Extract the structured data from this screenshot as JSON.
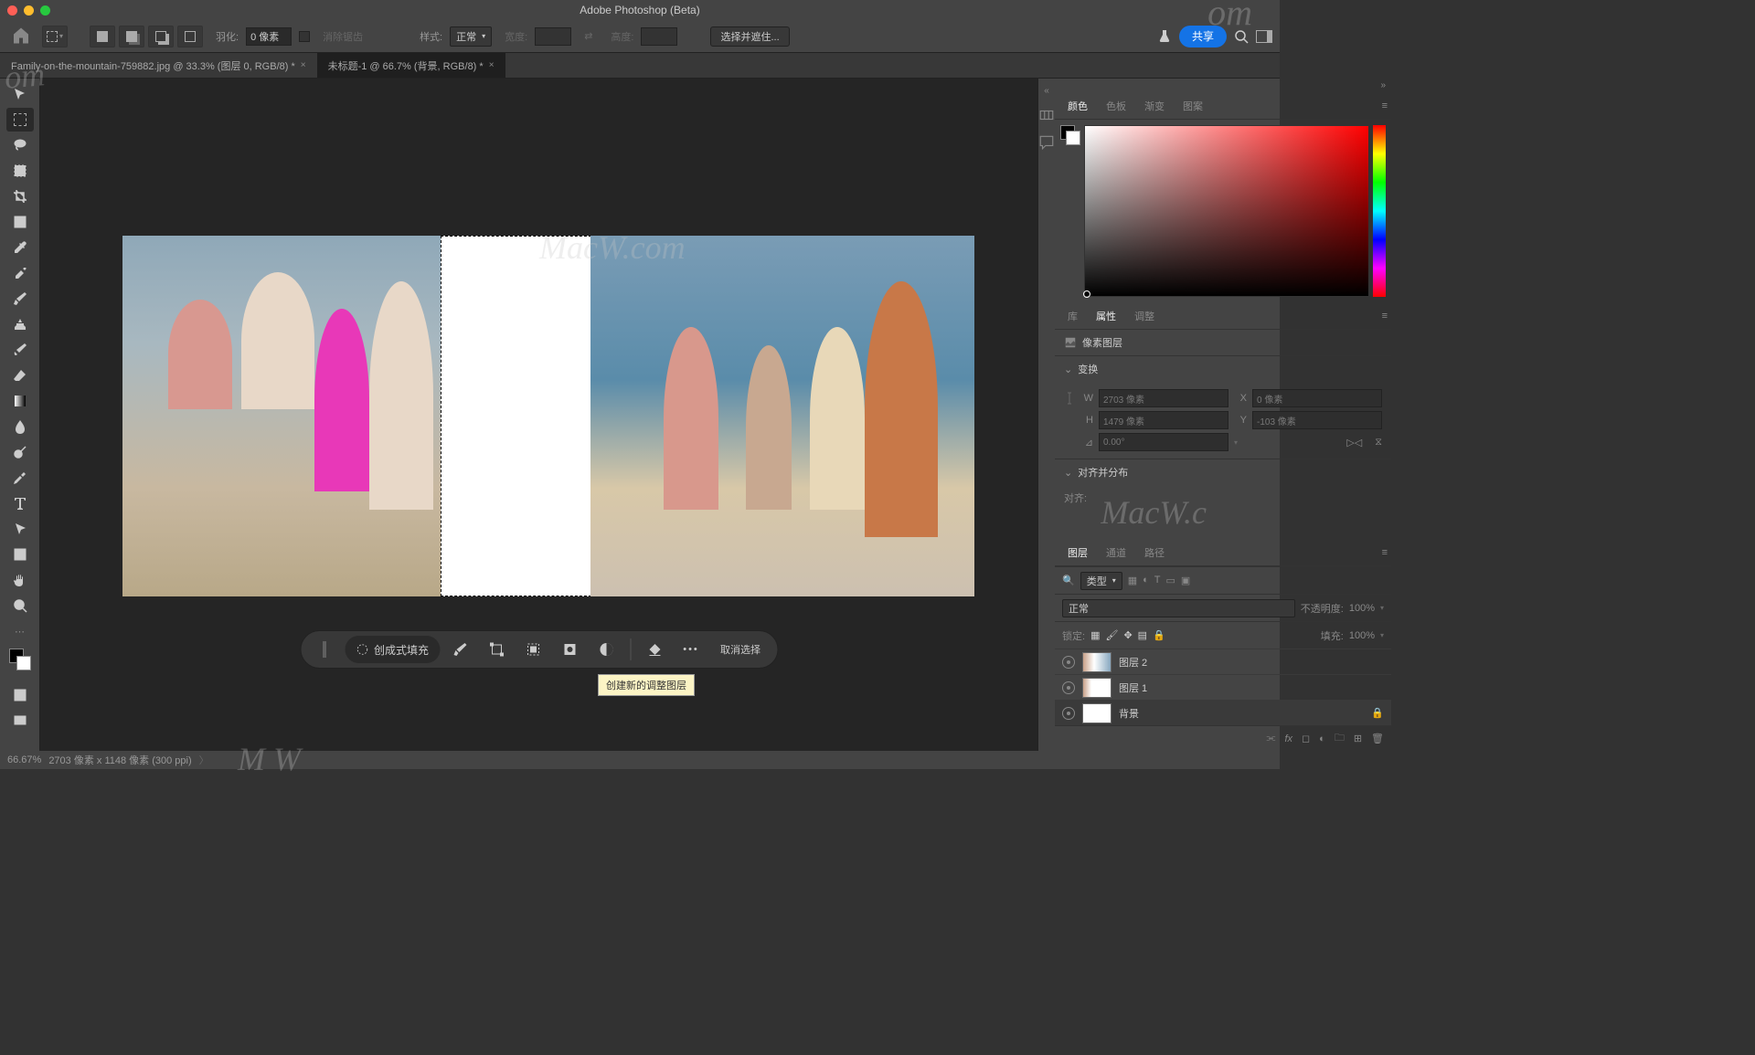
{
  "titlebar": {
    "title": "Adobe Photoshop (Beta)"
  },
  "toolbar": {
    "feather_label": "羽化:",
    "feather_value": "0 像素",
    "antialias": "消除锯齿",
    "style_label": "样式:",
    "style_value": "正常",
    "width_label": "宽度:",
    "height_label": "高度:",
    "select_and_mask": "选择并遮住...",
    "share": "共享"
  },
  "tabs": [
    {
      "label": "Family-on-the-mountain-759882.jpg @ 33.3% (图层 0, RGB/8) *",
      "active": false
    },
    {
      "label": "未标题-1 @ 66.7% (背景, RGB/8) *",
      "active": true
    }
  ],
  "floating_bar": {
    "generative_fill": "创成式填充",
    "deselect": "取消选择"
  },
  "tooltip": "创建新的调整图层",
  "color_panel": {
    "tabs": [
      "颜色",
      "色板",
      "渐变",
      "图案"
    ],
    "active": 0
  },
  "properties_panel": {
    "tabs": [
      "库",
      "属性",
      "调整"
    ],
    "active": 1,
    "subtitle": "像素图层",
    "transform": {
      "title": "变换",
      "W_lbl": "W",
      "W": "2703 像素",
      "X_lbl": "X",
      "X": "0 像素",
      "H_lbl": "H",
      "H": "1479 像素",
      "Y_lbl": "Y",
      "Y": "-103 像素",
      "angle": "0.00°"
    },
    "align": {
      "title": "对齐并分布",
      "sub": "对齐:"
    }
  },
  "layers_panel": {
    "tabs": [
      "图层",
      "通道",
      "路径"
    ],
    "active": 0,
    "filter_label": "类型",
    "blend_mode": "正常",
    "opacity_label": "不透明度:",
    "opacity_value": "100%",
    "lock_label": "锁定:",
    "fill_label": "填充:",
    "fill_value": "100%",
    "layers": [
      {
        "name": "图层 2",
        "thumb": "img"
      },
      {
        "name": "图层 1",
        "thumb": "img"
      },
      {
        "name": "背景",
        "thumb": "white",
        "locked": true
      }
    ]
  },
  "statusbar": {
    "zoom": "66.67%",
    "dims": "2703 像素 x 1148 像素 (300 ppi)"
  },
  "watermarks": {
    "w1": "om",
    "w2": "MacW.com",
    "w3": "om",
    "w4": "MacW.c",
    "w5": "M   W"
  }
}
